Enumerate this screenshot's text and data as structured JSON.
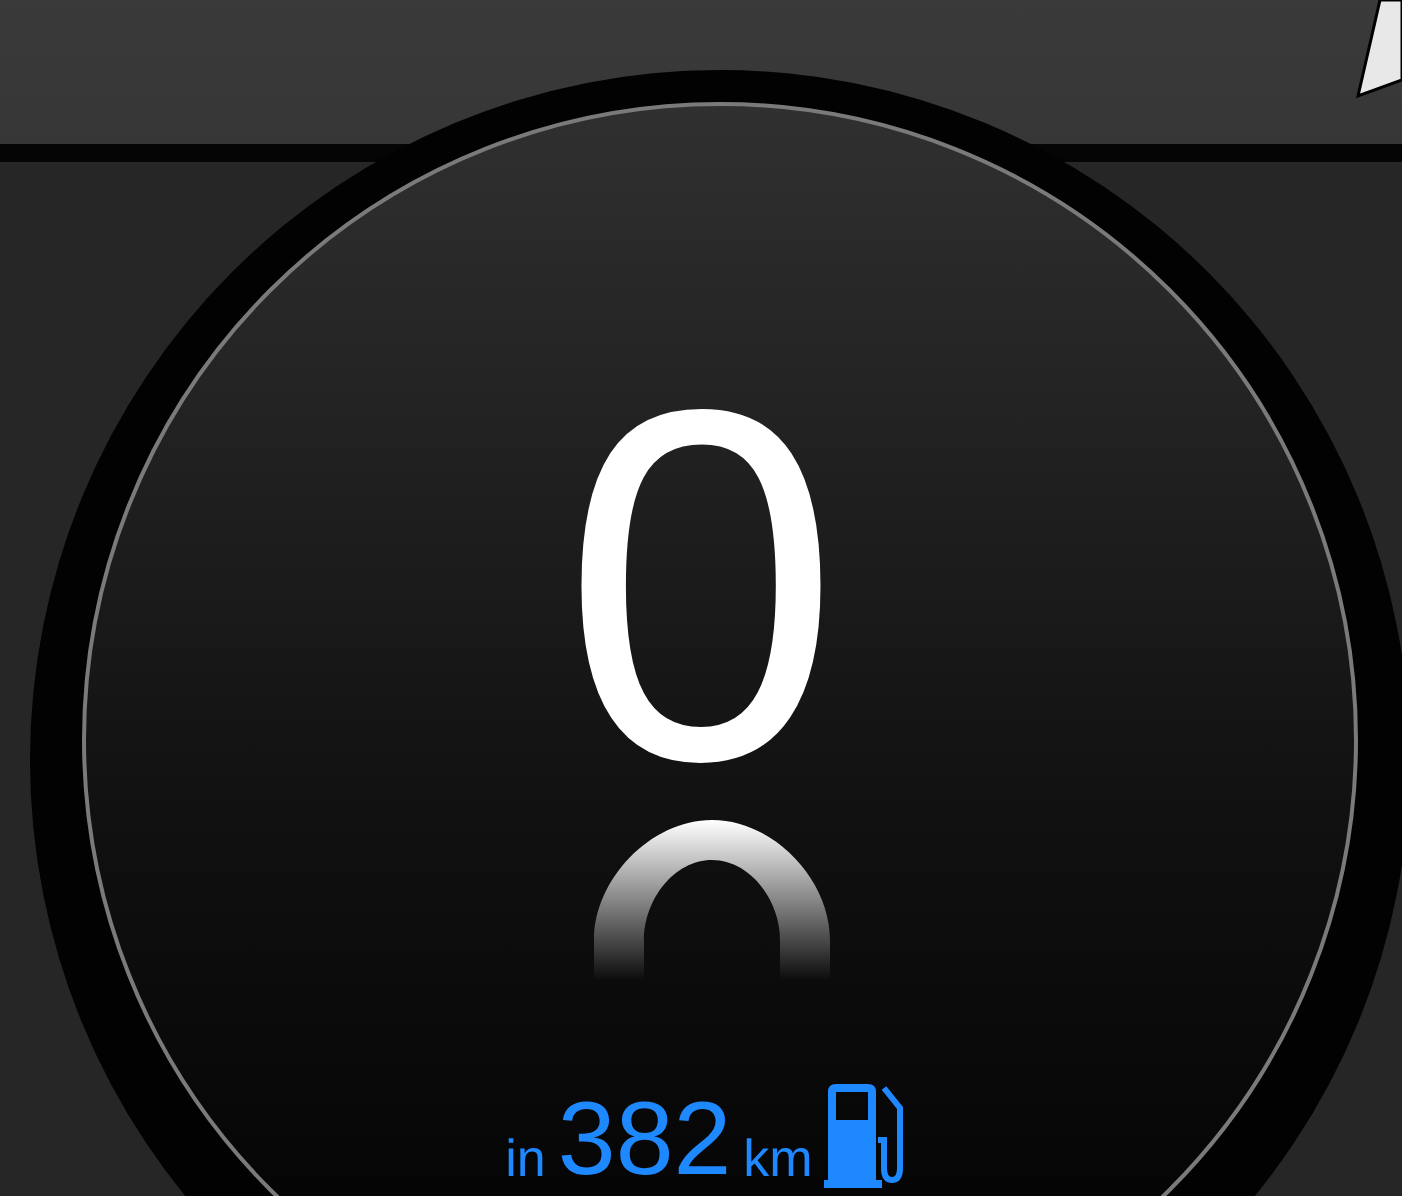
{
  "speed": "0",
  "range": {
    "prefix": "in",
    "value": "382",
    "unit": "km"
  }
}
